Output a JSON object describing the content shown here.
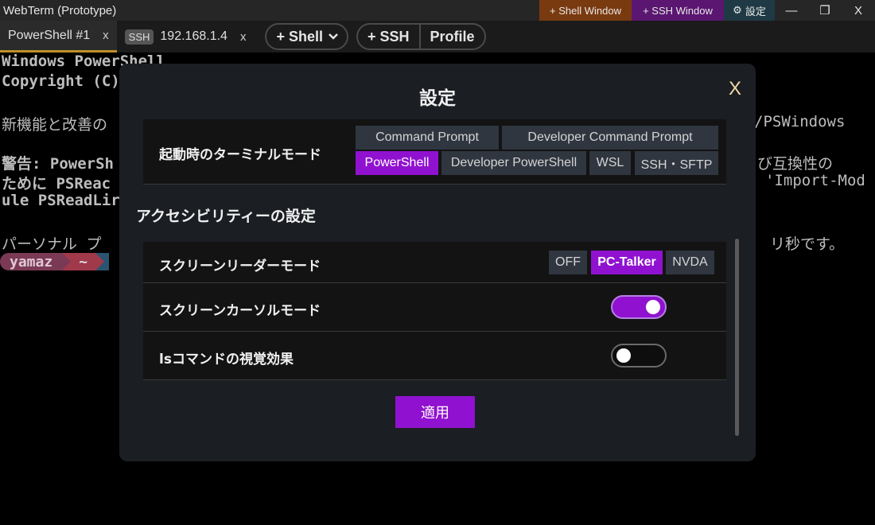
{
  "app": {
    "title": "WebTerm (Prototype)",
    "shell_window_label": "+ Shell Window",
    "ssh_window_label": "+ SSH Window",
    "settings_label": "設定",
    "minimize": "—",
    "maximize": "❐",
    "close": "X"
  },
  "tabs": [
    {
      "label": "PowerShell #1",
      "close": "x"
    },
    {
      "badge": "SSH",
      "label": "192.168.1.4",
      "close": "x"
    }
  ],
  "toolbar": {
    "shell_label": "+ Shell",
    "ssh_label": "+ SSH",
    "profile_label": "Profile"
  },
  "terminal": {
    "line1": "Windows PowerShell",
    "line2": "Copyright (C)",
    "line3_left": "新機能と改善の",
    "line3_right": "/PSWindows",
    "line4_left": "警告: PowerSh",
    "line4_right": "び互換性の",
    "line5_left": "ために PSReac",
    "line5_right": "'Import-Mod",
    "line6_left": "ule PSReadLir",
    "line7_left": "パーソナル プ",
    "line7_right": "リ秒です。",
    "prompt_user": "yamaz",
    "prompt_path": "~"
  },
  "colors": {
    "accent": "#9012d0",
    "tab_active_underline": "#c0902a"
  },
  "settings": {
    "title": "設定",
    "close": "X",
    "startup_mode": {
      "label": "起動時のターミナルモード",
      "options": [
        "Command Prompt",
        "Developer Command Prompt",
        "PowerShell",
        "Developer PowerShell",
        "WSL",
        "SSH・SFTP"
      ],
      "selected": "PowerShell"
    },
    "accessibility": {
      "heading": "アクセシビリティーの設定",
      "screen_reader": {
        "label": "スクリーンリーダーモード",
        "options": [
          "OFF",
          "PC-Talker",
          "NVDA"
        ],
        "selected": "PC-Talker"
      },
      "screen_cursor": {
        "label": "スクリーンカーソルモード",
        "enabled": true
      },
      "ls_visual": {
        "label": "lsコマンドの視覚効果",
        "enabled": false
      }
    },
    "apply_label": "適用"
  }
}
